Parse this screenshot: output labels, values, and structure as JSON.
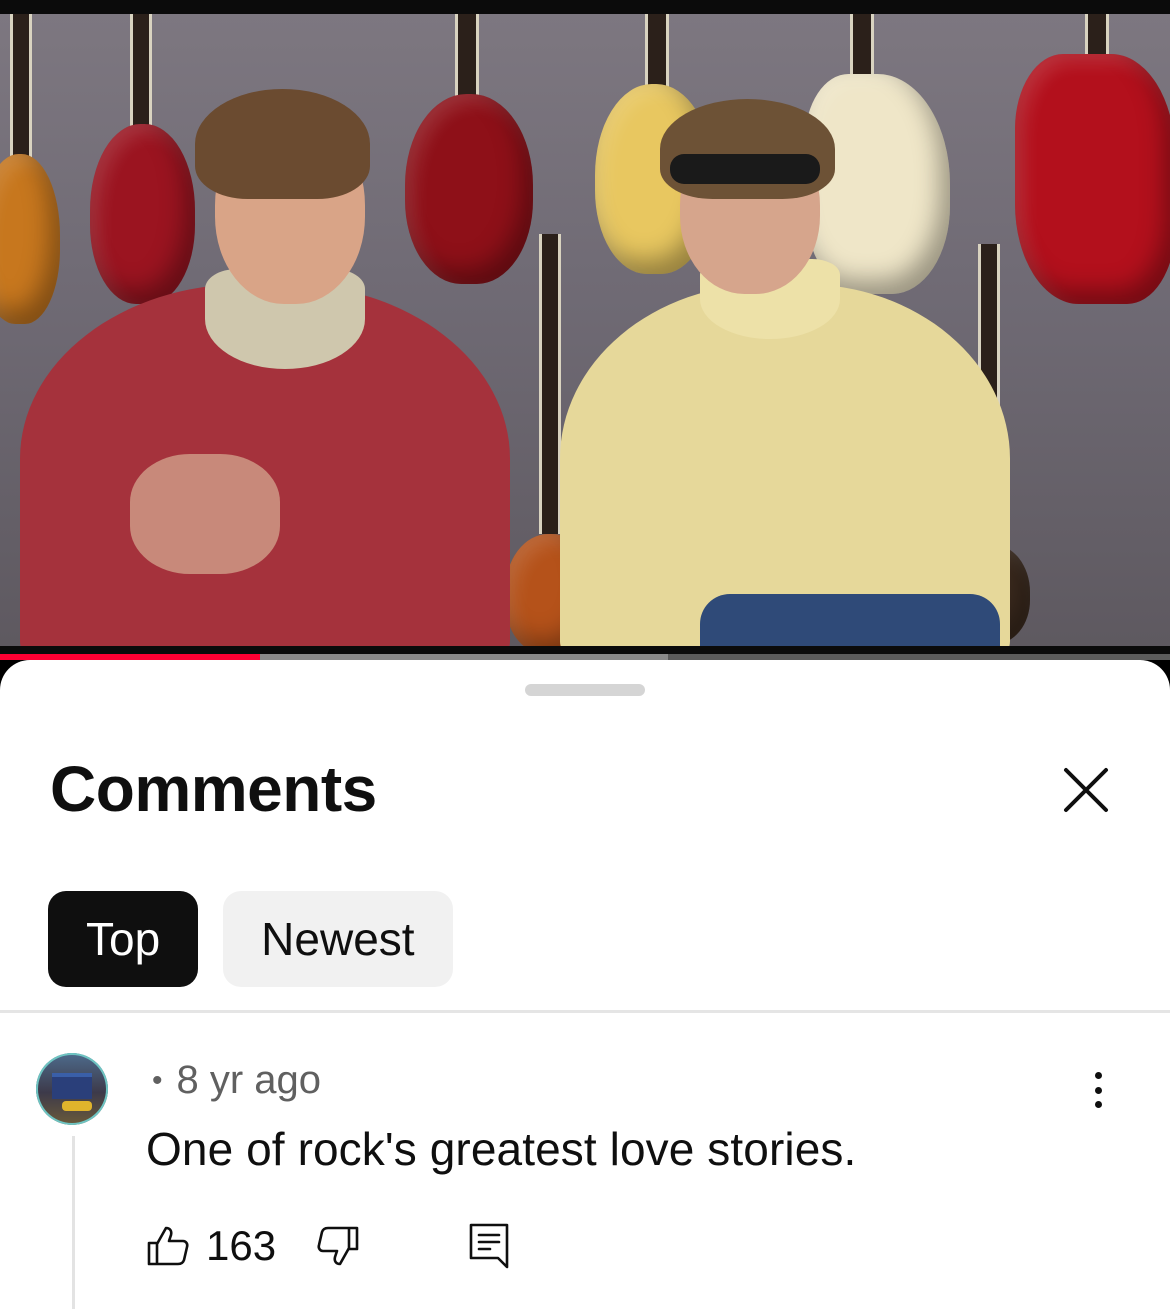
{
  "video": {
    "progress": {
      "played_fraction": 0.222,
      "buffered_fraction": 0.571
    }
  },
  "sheet": {
    "title": "Comments",
    "close_icon": "close-icon",
    "filters": [
      {
        "label": "Top",
        "active": true
      },
      {
        "label": "Newest",
        "active": false
      }
    ]
  },
  "comment": {
    "author": "",
    "separator": "•",
    "time": "8 yr ago",
    "text": "One of rock's greatest love stories.",
    "likes": "163",
    "icons": {
      "like": "thumbs-up-icon",
      "dislike": "thumbs-down-icon",
      "reply": "reply-icon",
      "more": "more-vertical-icon"
    }
  },
  "colors": {
    "accent": "#ff0033",
    "text_primary": "#0f0f0f",
    "text_secondary": "#606060",
    "chip_inactive": "#f1f1f1"
  }
}
